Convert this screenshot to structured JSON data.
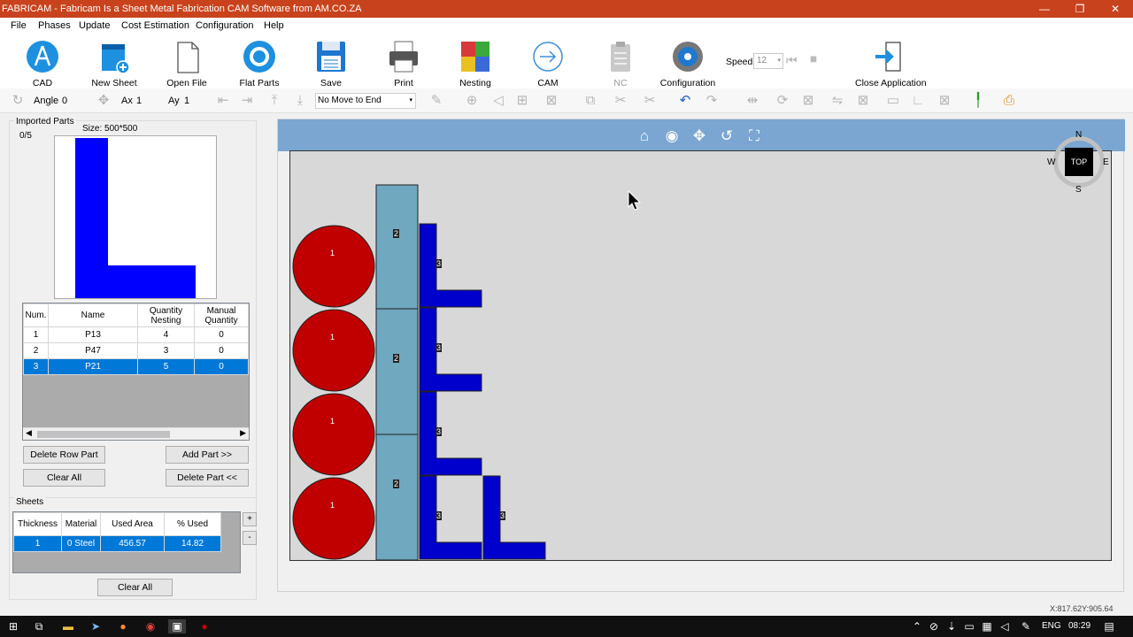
{
  "window": {
    "title": "FABRICAM - Fabricam Is a Sheet Metal Fabrication CAM Software from AM.CO.ZA",
    "minimize": "—",
    "maximize": "❐",
    "close": "✕"
  },
  "menu": [
    "File",
    "Phases",
    "Update",
    "Cost Estimation",
    "Configuration",
    "Help"
  ],
  "ribbon": {
    "cad": "CAD",
    "new_sheet": "New Sheet",
    "open_file": "Open File",
    "flat_parts": "Flat Parts",
    "save": "Save",
    "print": "Print",
    "nesting": "Nesting",
    "cam": "CAM",
    "nc": "NC",
    "configuration": "Configuration",
    "speed_label": "Speed",
    "speed_value": "12",
    "close_app": "Close Application"
  },
  "toolbar": {
    "angle_label": "Angle",
    "angle_value": "0",
    "ax_label": "Ax",
    "ax_value": "1",
    "ay_label": "Ay",
    "ay_value": "1",
    "move_select": "No Move to End"
  },
  "imported_parts": {
    "group_label": "Imported Parts",
    "count": "0/5",
    "size": "Size: 500*500",
    "columns": [
      "Num.",
      "Name",
      "Quantity Nesting",
      "Manual Quantity"
    ],
    "rows": [
      {
        "num": "1",
        "name": "P13",
        "qty": "4",
        "manual": "0"
      },
      {
        "num": "2",
        "name": "P47",
        "qty": "3",
        "manual": "0"
      },
      {
        "num": "3",
        "name": "P21",
        "qty": "5",
        "manual": "0"
      }
    ],
    "selected_row": 2,
    "delete_row": "Delete Row Part",
    "add_part": "Add Part >>",
    "clear_all": "Clear All",
    "delete_part": "Delete Part <<"
  },
  "sheets": {
    "group_label": "Sheets",
    "columns": [
      "Thickness",
      "Material",
      "Used Area",
      "% Used"
    ],
    "rows": [
      {
        "thickness": "1",
        "material": "0 Steel",
        "area": "456.57",
        "used": "14.82"
      }
    ],
    "plus": "+",
    "minus": "-",
    "clear_all": "Clear All"
  },
  "viewcube": {
    "top": "TOP",
    "n": "N",
    "s": "S",
    "e": "E",
    "w": "W"
  },
  "part_labels": {
    "circle": "1",
    "rect": "2",
    "lshape": "3"
  },
  "status": {
    "coords": "X:817.62Y:905.64"
  },
  "taskbar": {
    "lang": "ENG",
    "time": "08:29"
  },
  "colors": {
    "titlebar": "#c8431d",
    "circle": "#c00000",
    "rect": "#6fa8bf",
    "lshape": "#0000cc",
    "accent": "#0078d7"
  }
}
